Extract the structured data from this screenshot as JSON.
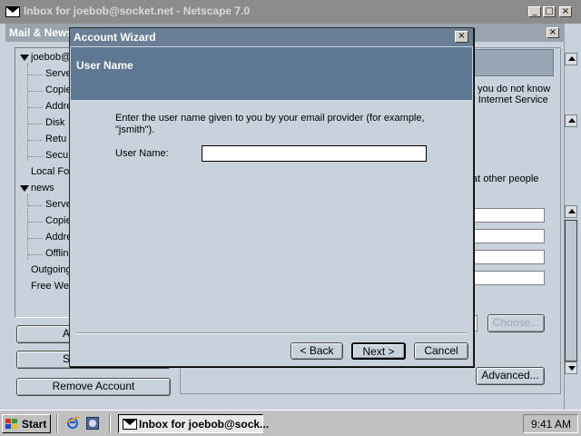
{
  "main_window": {
    "title": "Inbox for joebob@socket.net - Netscape 7.0",
    "controls": {
      "minimize": "_",
      "maximize": "□",
      "close": "×"
    }
  },
  "account_settings": {
    "title": "Mail & News",
    "tree": [
      {
        "label": "joebob@",
        "expanded": true
      },
      {
        "label": "Serve"
      },
      {
        "label": "Copie"
      },
      {
        "label": "Addre"
      },
      {
        "label": "Disk"
      },
      {
        "label": "Retu"
      },
      {
        "label": "Secu"
      },
      {
        "label": "Local Fo"
      },
      {
        "label": "news",
        "expanded": true
      },
      {
        "label": "Serve"
      },
      {
        "label": "Copie"
      },
      {
        "label": "Addre"
      },
      {
        "label": "Offlin"
      },
      {
        "label": "Outgoing"
      },
      {
        "label": "Free We"
      }
    ],
    "buttons": {
      "add_partial": "A",
      "set_partial": "S",
      "remove_account": "Remove Account"
    },
    "right_text": {
      "line1": "f you do not know",
      "line2": "r Internet Service",
      "line3": "at other people"
    },
    "choose_button": "Choose...",
    "advanced_button": "Advanced..."
  },
  "wizard": {
    "title": "Account Wizard",
    "header": "User Name",
    "instruction_line1": "Enter the user name given to you by your email provider (for example,",
    "instruction_line2": "\"jsmith\").",
    "username_label": "User Name:",
    "username_value": "",
    "back_button": "< Back",
    "next_button": "Next >",
    "cancel_button": "Cancel",
    "close_glyph": "×"
  },
  "taskbar": {
    "start": "Start",
    "task": "Inbox for joebob@sock...",
    "clock": "9:41 AM"
  }
}
